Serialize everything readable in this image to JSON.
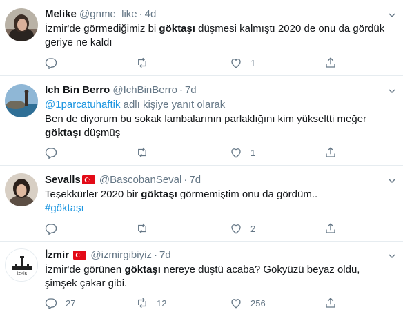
{
  "colors": {
    "link": "#1b95e0",
    "muted": "#657786",
    "text": "#14171a",
    "divider": "#e6ecf0"
  },
  "tweets": [
    {
      "name": "Melike",
      "handle": "@gnme_like",
      "time": "4d",
      "text_parts": [
        "İzmir'de görmediğimiz bi ",
        "göktaşı",
        " düşmesi kalmıştı 2020 de onu da gördük geriye ne kaldı"
      ],
      "reply_count": "",
      "retweet_count": "",
      "like_count": "1"
    },
    {
      "name": "Ich Bin Berro",
      "handle": "@IchBinBerro",
      "time": "7d",
      "reply_to_handle": "@1parcatuhaftik",
      "reply_to_suffix": " adlı kişiye yanıt olarak",
      "text_parts": [
        "Ben de diyorum bu sokak lambalarının parlaklığını kim yükseltti meğer ",
        "göktaşı",
        " düşmüş"
      ],
      "reply_count": "",
      "retweet_count": "",
      "like_count": "1"
    },
    {
      "name": "Sevalls",
      "handle": "@BascobanSeval",
      "time": "7d",
      "text_parts": [
        "Teşekkürler 2020 bir ",
        "göktaşı",
        " görmemiştim onu da gördüm.."
      ],
      "hashtag": "#göktaşı",
      "reply_count": "",
      "retweet_count": "",
      "like_count": "2"
    },
    {
      "name": "İzmir",
      "handle": "@izmirgibiyiz",
      "time": "7d",
      "avatar_text": "İZMİR",
      "text_parts": [
        "İzmir'de görünen ",
        "göktaşı",
        " nereye düştü acaba? Gökyüzü beyaz oldu, şimşek çakar gibi."
      ],
      "reply_count": "27",
      "retweet_count": "12",
      "like_count": "256"
    }
  ],
  "icons": {
    "reply": "reply-icon",
    "retweet": "retweet-icon",
    "like": "heart-icon",
    "share": "share-icon",
    "more": "chevron-down-icon",
    "flag": "turkey-flag-icon"
  }
}
